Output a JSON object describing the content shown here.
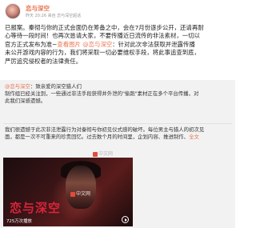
{
  "post": {
    "author": "恋与深空",
    "meta": "昨天 20:26 来自 恋与深空超话",
    "lines": [
      "已报案。秦彻与你的正式会面仍在筹备之中，会在7月份逐步公开，还请再耐",
      "心等待一段时间！也再次恳请大家，不要传播近日流传的非法素材，一切以",
      "官方正式发布为准~",
      "：针对此次非法获取并泄露传播",
      "未公开游戏内容的行为，我们将采取一切必要维权手段，将此事追查到底，",
      "严厉追究侵权者的法律责任。"
    ],
    "link_images": "查看图片",
    "link_mention": "@恋与深空"
  },
  "repost": {
    "mention": "@恋与深空",
    "intro": "致亲爱的深空猎人们",
    "lines": [
      "制作组已经关注到，一些通过非法手段获得并外泄的\"偷跑\"素材正在多个平台传播，对",
      "此我们深感遗憾。"
    ],
    "body_lines": [
      "我们很遗憾于此次非法泄露行为对秦彻与你初见仪式感的破坏。每位男主与猎人的初次见",
      "面，都是一次不可重来的珍贵回忆。过去数个月的时间里，企划内容、推进制作、",
      "…全文"
    ],
    "more": "全文"
  },
  "video": {
    "title_art": "恋与深空",
    "play_count": "725万次播放",
    "watermark": "中文网"
  },
  "watermark_mid": "中文网"
}
